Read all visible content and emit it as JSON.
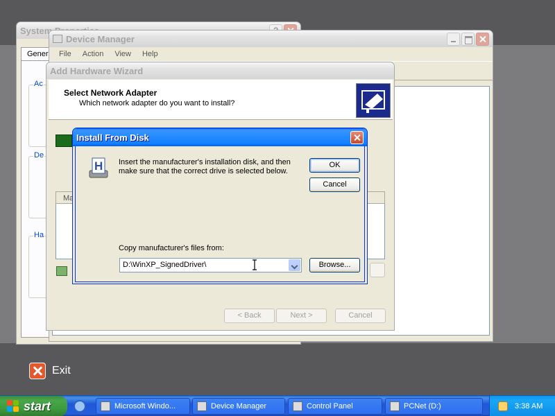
{
  "system_properties": {
    "title": "System Properties",
    "tab_general": "General",
    "group_labels": [
      "Ac",
      "De",
      "Ha"
    ]
  },
  "device_manager": {
    "title": "Device Manager",
    "menu": [
      "File",
      "Action",
      "View",
      "Help"
    ]
  },
  "wizard": {
    "title": "Add Hardware Wizard",
    "heading": "Select Network Adapter",
    "subheading": "Which network adapter do you want to install?",
    "list_header": "Ma",
    "back_label": "< Back",
    "next_label": "Next >",
    "cancel_label": "Cancel"
  },
  "install_from_disk": {
    "title": "Install From Disk",
    "message": "Insert the manufacturer's installation disk, and then make sure that the correct drive is selected below.",
    "ok_label": "OK",
    "cancel_label": "Cancel",
    "copy_label": "Copy manufacturer's files from:",
    "path_value": "D:\\WinXP_SignedDriver\\",
    "browse_label": "Browse..."
  },
  "exit": {
    "label": "Exit"
  },
  "taskbar": {
    "start_label": "start",
    "tasks": [
      {
        "label": "Microsoft Windo...",
        "icon": "window-icon"
      },
      {
        "label": "Device Manager",
        "icon": "computer-icon"
      },
      {
        "label": "Control Panel",
        "icon": "control-panel-icon"
      },
      {
        "label": "PCNet (D:)",
        "icon": "cd-drive-icon"
      }
    ],
    "clock": "3:38 AM"
  },
  "colors": {
    "title_active": "#0058ee",
    "taskbar": "#245edb",
    "start": "#3f9c3f",
    "exit": "#e5582d"
  }
}
